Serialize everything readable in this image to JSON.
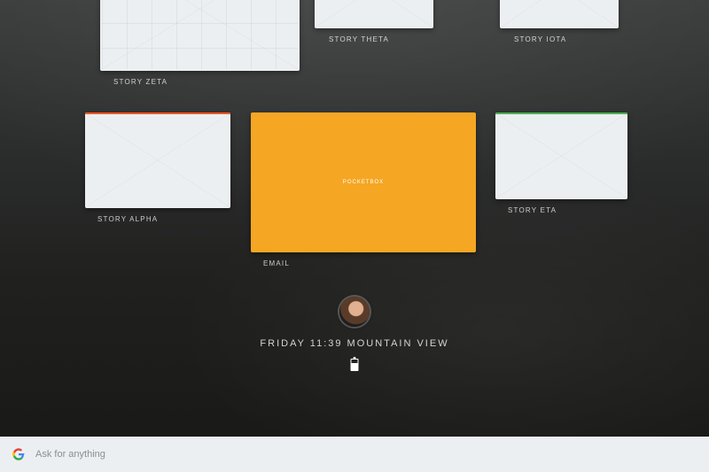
{
  "cards": {
    "zeta": {
      "label": "STORY ZETA"
    },
    "theta": {
      "label": "STORY THETA"
    },
    "iota": {
      "label": "STORY IOTA"
    },
    "alpha": {
      "label": "STORY ALPHA"
    },
    "eta": {
      "label": "STORY ETA"
    },
    "email": {
      "label": "EMAIL",
      "center": "POCKETBOX"
    }
  },
  "status": {
    "line": "FRIDAY 11:39 MOUNTAIN VIEW"
  },
  "search": {
    "placeholder": "Ask for anything"
  }
}
